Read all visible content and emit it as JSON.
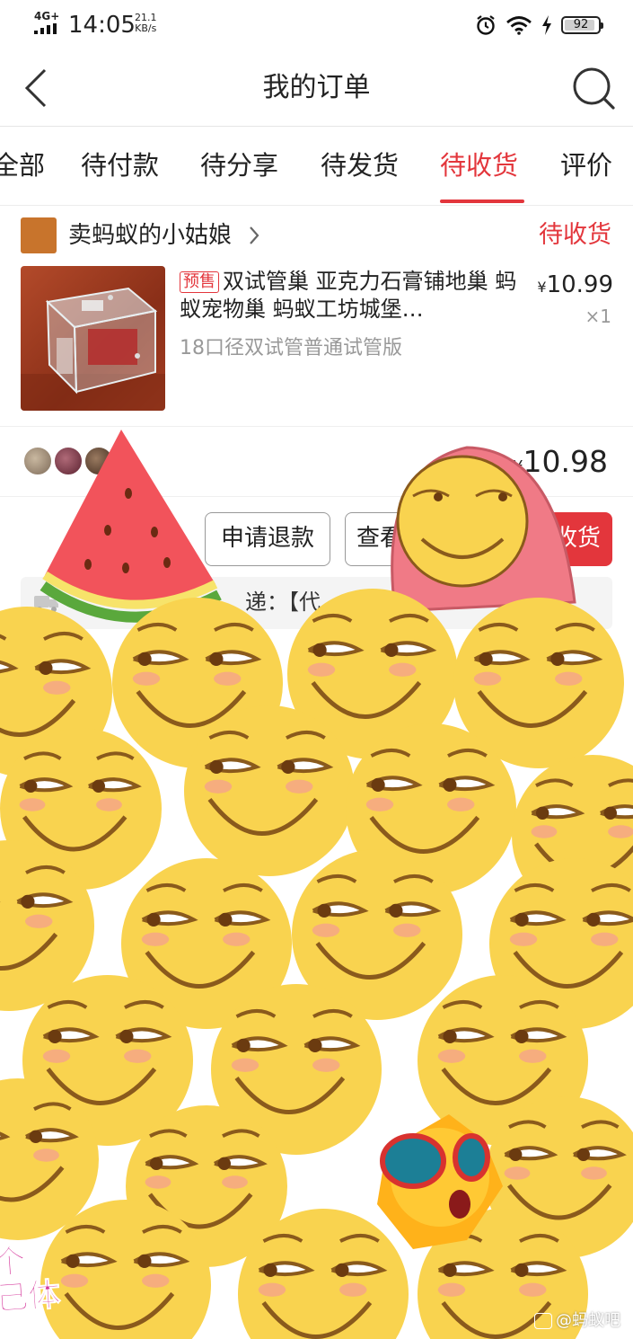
{
  "status_bar": {
    "network": "4G+",
    "time": "14:05",
    "speed_value": "21.1",
    "speed_unit": "KB/s",
    "battery": "92",
    "battery_level": 0.92,
    "icons": [
      "signal-icon",
      "alarm-icon",
      "wifi-icon",
      "charging-icon",
      "battery-icon"
    ]
  },
  "header": {
    "title": "我的订单",
    "back_icon": "back-arrow-icon",
    "search_icon": "search-icon"
  },
  "tabs": [
    {
      "label": "全部",
      "active": false
    },
    {
      "label": "待付款",
      "active": false
    },
    {
      "label": "待分享",
      "active": false
    },
    {
      "label": "待发货",
      "active": false
    },
    {
      "label": "待收货",
      "active": true
    },
    {
      "label": "评价",
      "active": false
    }
  ],
  "order": {
    "shop_name": "卖蚂蚁的小姑娘",
    "shop_logo_text": "卖蚂蚁的小姑娘",
    "status": "待收货",
    "product": {
      "tag": "预售",
      "title": "双试管巢 亚克力石膏铺地巢 蚂蚁宠物巢 蚂蚁工坊城堡…",
      "spec": "18口径双试管普通试管版",
      "currency": "¥",
      "price": "10.99",
      "quantity": "×1"
    },
    "total": {
      "currency": "¥",
      "price": "10.98"
    },
    "buttons": {
      "refund": "申请退款",
      "logistics": "查看",
      "confirm": "收货"
    },
    "logistics_text": "递：【代"
  },
  "overlay": {
    "caption": "个\n己体",
    "watermark": "@蚂蚁吧"
  },
  "colors": {
    "accent": "#e3363c",
    "sticker_face": "#f9d34f",
    "sticker_outline": "#8a5a1c"
  }
}
